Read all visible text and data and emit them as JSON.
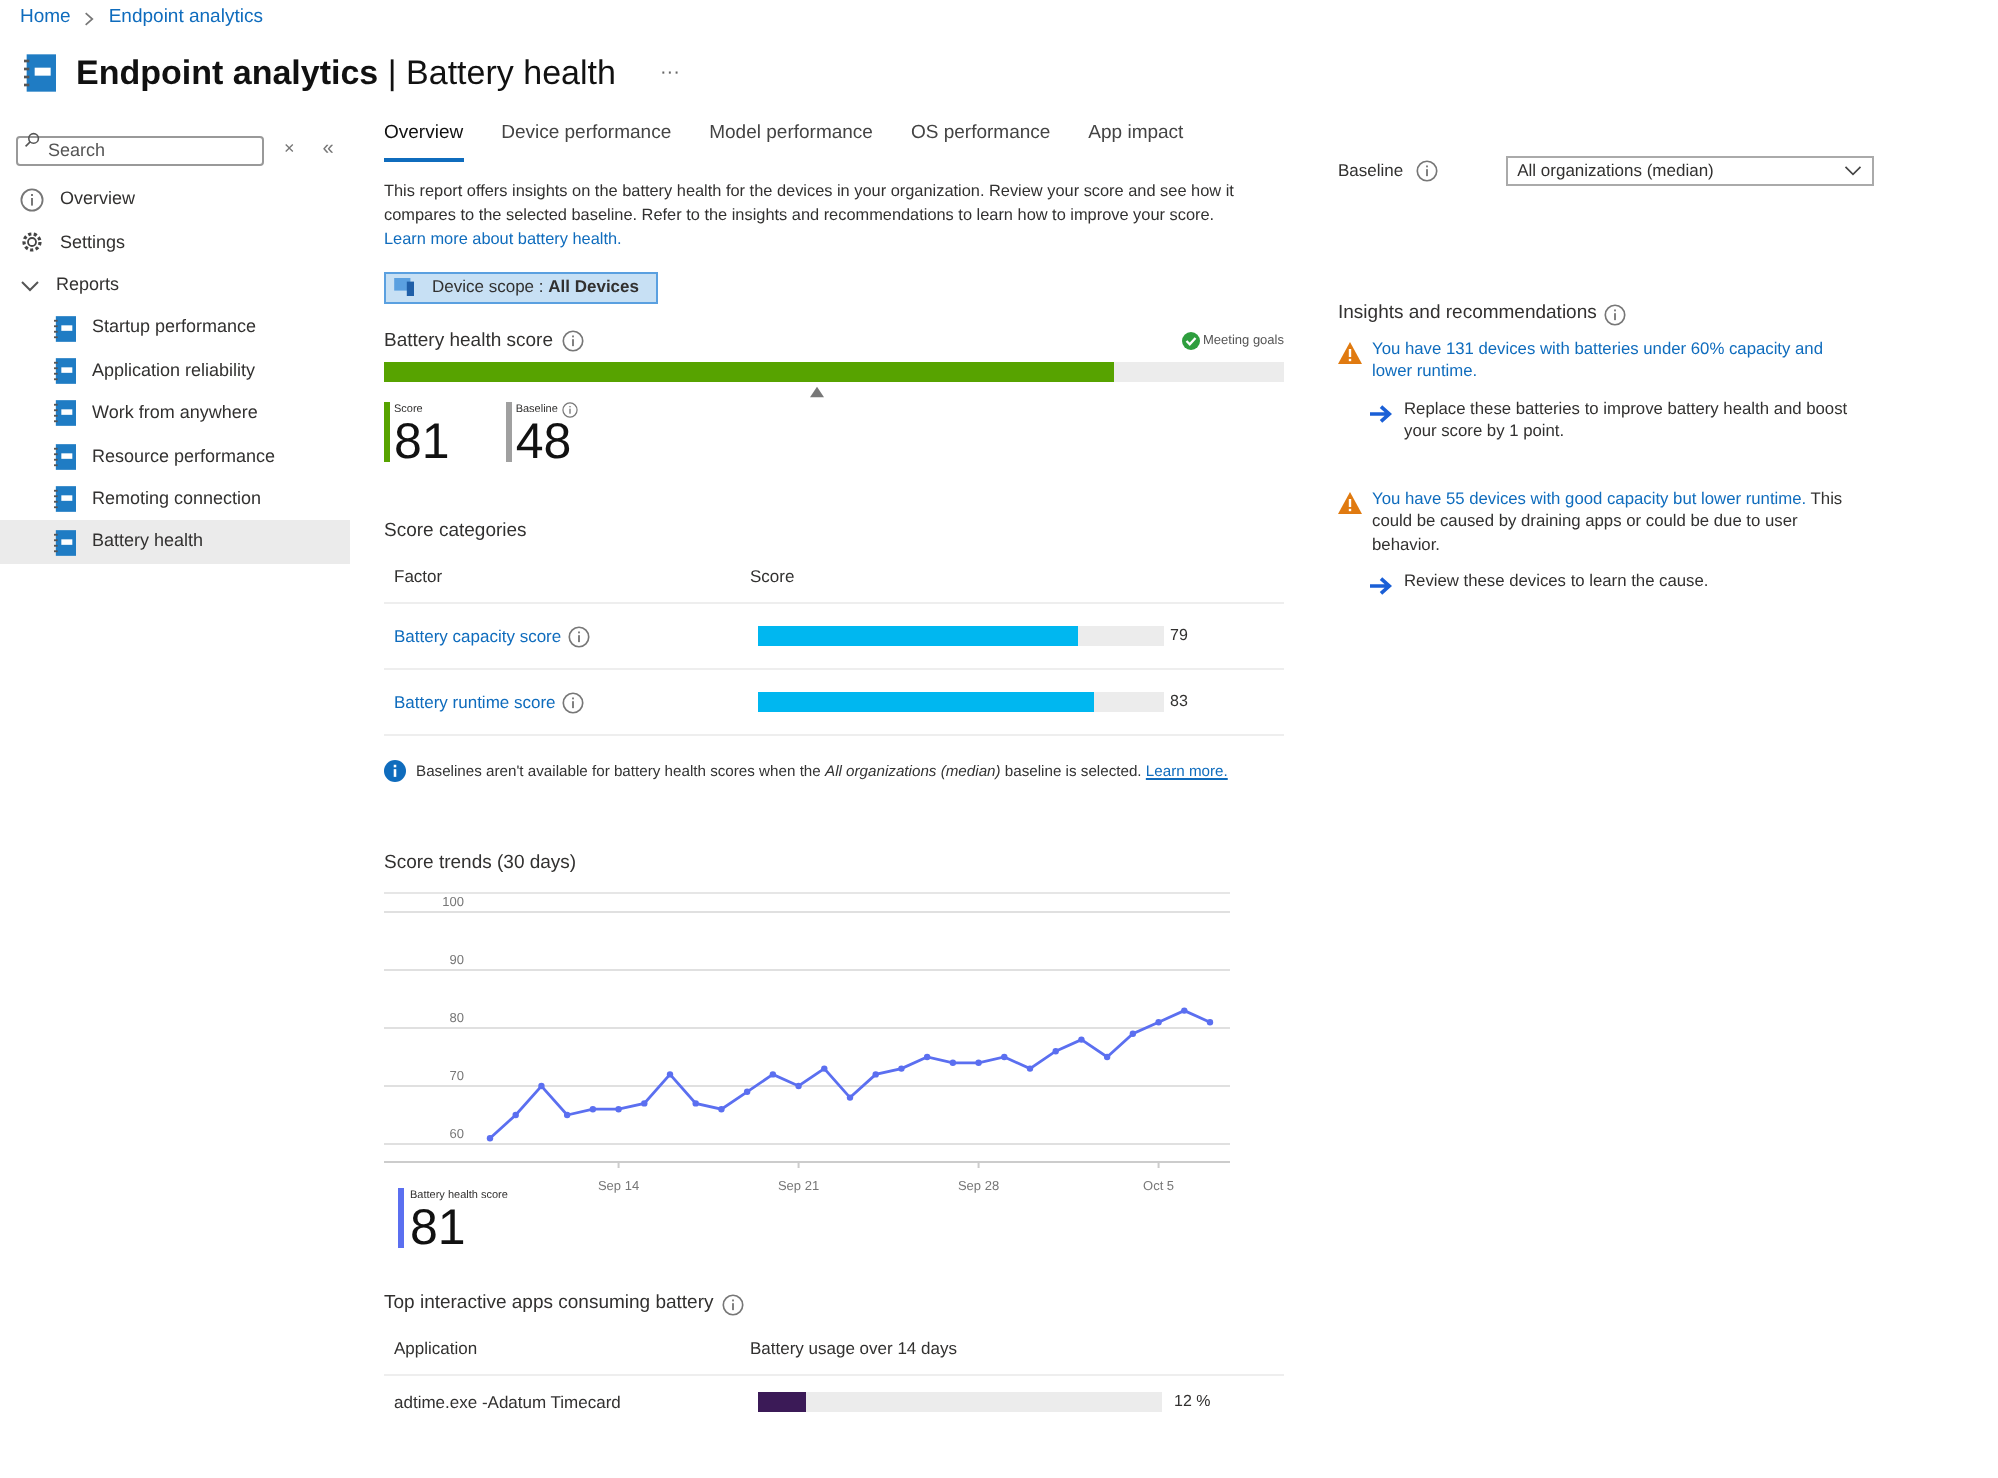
{
  "breadcrumb": [
    "Home",
    "Endpoint analytics"
  ],
  "page": {
    "title": "Endpoint analytics",
    "separator": "|",
    "subtitle": "Battery health",
    "more": "···"
  },
  "sidebar": {
    "search": {
      "placeholder": "Search"
    },
    "clear": "×",
    "collapse": "«",
    "items": [
      {
        "label": "Overview",
        "kind": "info",
        "selected": false
      },
      {
        "label": "Settings",
        "kind": "gear",
        "selected": false
      },
      {
        "label": "Reports",
        "kind": "group",
        "expanded": true,
        "selected": false,
        "children": [
          {
            "label": "Startup performance",
            "kind": "report",
            "selected": false
          },
          {
            "label": "Application reliability",
            "kind": "report",
            "selected": false
          },
          {
            "label": "Work from anywhere",
            "kind": "report",
            "selected": false
          },
          {
            "label": "Resource performance",
            "kind": "report",
            "selected": false
          },
          {
            "label": "Remoting connection",
            "kind": "report",
            "selected": false
          },
          {
            "label": "Battery health",
            "kind": "report",
            "selected": true
          }
        ]
      }
    ]
  },
  "tabs": [
    {
      "label": "Overview",
      "selected": true
    },
    {
      "label": "Device performance",
      "selected": false
    },
    {
      "label": "Model performance",
      "selected": false
    },
    {
      "label": "OS performance",
      "selected": false
    },
    {
      "label": "App impact",
      "selected": false
    }
  ],
  "intro": {
    "text": "This report offers insights on the battery health for the devices in your organization. Review your score and see how it compares to the selected baseline. Refer to the insights and recommendations to learn how to improve your score.",
    "link": "Learn more about battery health."
  },
  "device_scope": "Device scope : **All Devices**",
  "health_score": {
    "title": "Battery health score",
    "status": "Meeting goals",
    "level": 0.81,
    "baseline_marker": {
      "level": 0.48
    },
    "tiles": [
      {
        "label": "Score",
        "value": "81",
        "color": "#57a300",
        "info": false
      },
      {
        "label": "Baseline",
        "value": "48",
        "color": "#a0a0a0",
        "info": true
      }
    ]
  },
  "score_categories": {
    "title": "Score categories",
    "columns": [
      "Factor",
      "Score"
    ],
    "rows": [
      {
        "factor": "Battery capacity score",
        "level": 0.79,
        "value": "79"
      },
      {
        "factor": "Battery runtime score",
        "level": 0.83,
        "value": "83"
      }
    ]
  },
  "notice": {
    "text": "Baselines aren't available for battery health scores when the *All organizations (median)* baseline is selected.",
    "link": "Learn more."
  },
  "score_trends": {
    "title": "Score trends (30 days)",
    "chart_data": {
      "type": "line",
      "categories": [
        null,
        null,
        null,
        null,
        null,
        "Sep 14",
        null,
        null,
        null,
        null,
        null,
        null,
        "Sep 21",
        null,
        null,
        null,
        null,
        null,
        null,
        "Sep 28",
        null,
        null,
        null,
        null,
        null,
        null,
        "Oct 5",
        null,
        null
      ],
      "series": [
        {
          "name": "Battery health score",
          "color": "#5b6ff0",
          "marker": true,
          "values": [
            61,
            65,
            70,
            65,
            66,
            66,
            67,
            72,
            67,
            66,
            69,
            72,
            70,
            73,
            68,
            72,
            73,
            75,
            74,
            74,
            75,
            73,
            76,
            78,
            75,
            79,
            81,
            83,
            81
          ]
        }
      ],
      "grid": true,
      "ylim": [
        60,
        100
      ],
      "yticks": [
        60,
        70,
        80,
        90,
        100
      ]
    },
    "legend": {
      "value": "81"
    }
  },
  "top_apps": {
    "title": "Top interactive apps consuming battery",
    "columns": [
      "Application",
      "Battery usage over 14 days"
    ],
    "rows": [
      {
        "application": "adtime.exe -Adatum Timecard",
        "level": 0.12,
        "value": "12 %"
      }
    ]
  },
  "baseline": {
    "label": "Baseline",
    "value": "All organizations (median)"
  },
  "insights": {
    "title": "Insights and recommendations",
    "items": [
      {
        "link": "You have 131 devices with batteries under 60% capacity and lower runtime.",
        "action": "Replace these batteries to improve battery health and boost your score by 1 point."
      },
      {
        "link": "You have 55 devices with good capacity but lower runtime.",
        "text": "This could be caused by draining apps or could be due to user behavior.",
        "action": "Review these devices to learn the cause."
      }
    ]
  }
}
